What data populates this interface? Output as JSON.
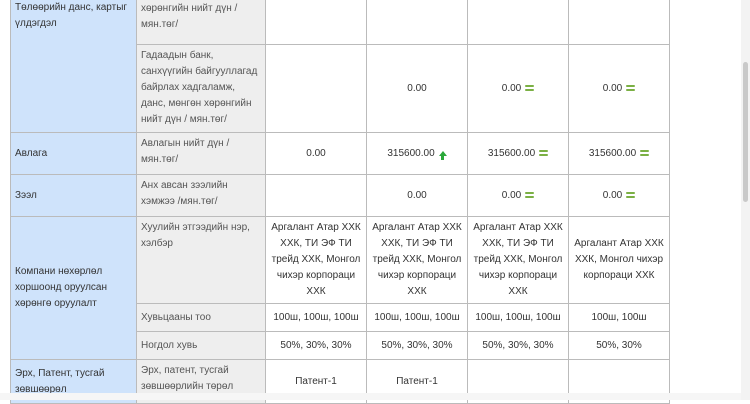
{
  "rows": {
    "bank_cat": "Төлөөрийн данс, картыг үлдэгдэл",
    "bank_top_sub": "хөрөнгийн нийт дүн / мян.төг/",
    "foreign": {
      "sub": "Гадаадын банк, санхүүгийн байгууллагад байрлах хадгаламж, данс, мөнгөн хөрөнгийн нийт дүн / мян.төг/",
      "v": [
        "",
        "0.00",
        "0.00",
        "0.00"
      ]
    },
    "avlaga": {
      "cat": "Авлага",
      "sub": "Авлагын нийт дүн / мян.төг/",
      "v": [
        "0.00",
        "315600.00",
        "315600.00",
        "315600.00"
      ]
    },
    "zeel": {
      "cat": "Зээл",
      "sub": "Анх авсан зээлийн хэмжээ /мян.төг/",
      "v": [
        "",
        "0.00",
        "0.00",
        "0.00"
      ]
    },
    "company": {
      "cat": "Компани нөхөрлөл хоршоонд оруулсан хөрөнгө оруулалт",
      "entity": {
        "sub": "Хуулийн этгээдийн нэр, хэлбэр",
        "v": [
          "Аргалант Атар ХХК ХХК, ТИ ЭФ ТИ трейд ХХК, Монгол чихэр корпораци ХХК",
          "Аргалант Атар ХХК ХХК, ТИ ЭФ ТИ трейд ХХК, Монгол чихэр корпораци ХХК",
          "Аргалант Атар ХХК ХХК, ТИ ЭФ ТИ трейд ХХК, Монгол чихэр корпораци ХХК",
          "Аргалант Атар ХХК ХХК, Монгол чихэр корпораци ХХК"
        ]
      },
      "shares": {
        "sub": "Хувьцааны тоо",
        "v": [
          "100ш, 100ш, 100ш",
          "100ш, 100ш, 100ш",
          "100ш, 100ш, 100ш",
          "100ш, 100ш"
        ]
      },
      "portion": {
        "sub": "Ногдол хувь",
        "v": [
          "50%, 30%, 30%",
          "50%, 30%, 30%",
          "50%, 30%, 30%",
          "50%, 30%"
        ]
      }
    },
    "patent": {
      "cat": "Эрх, Патент, тусгай зөвшөөрөл",
      "sub": "Эрх, патент, тусгай зөвшөөрлийн төрөл",
      "v": [
        "Патент-1",
        "Патент-1",
        "",
        ""
      ]
    }
  },
  "colors": {
    "category_bg": "#cfe3fb",
    "subcategory_bg": "#eeeeee",
    "indicator_equal": "#7bb044",
    "indicator_up": "#2aa83a"
  }
}
